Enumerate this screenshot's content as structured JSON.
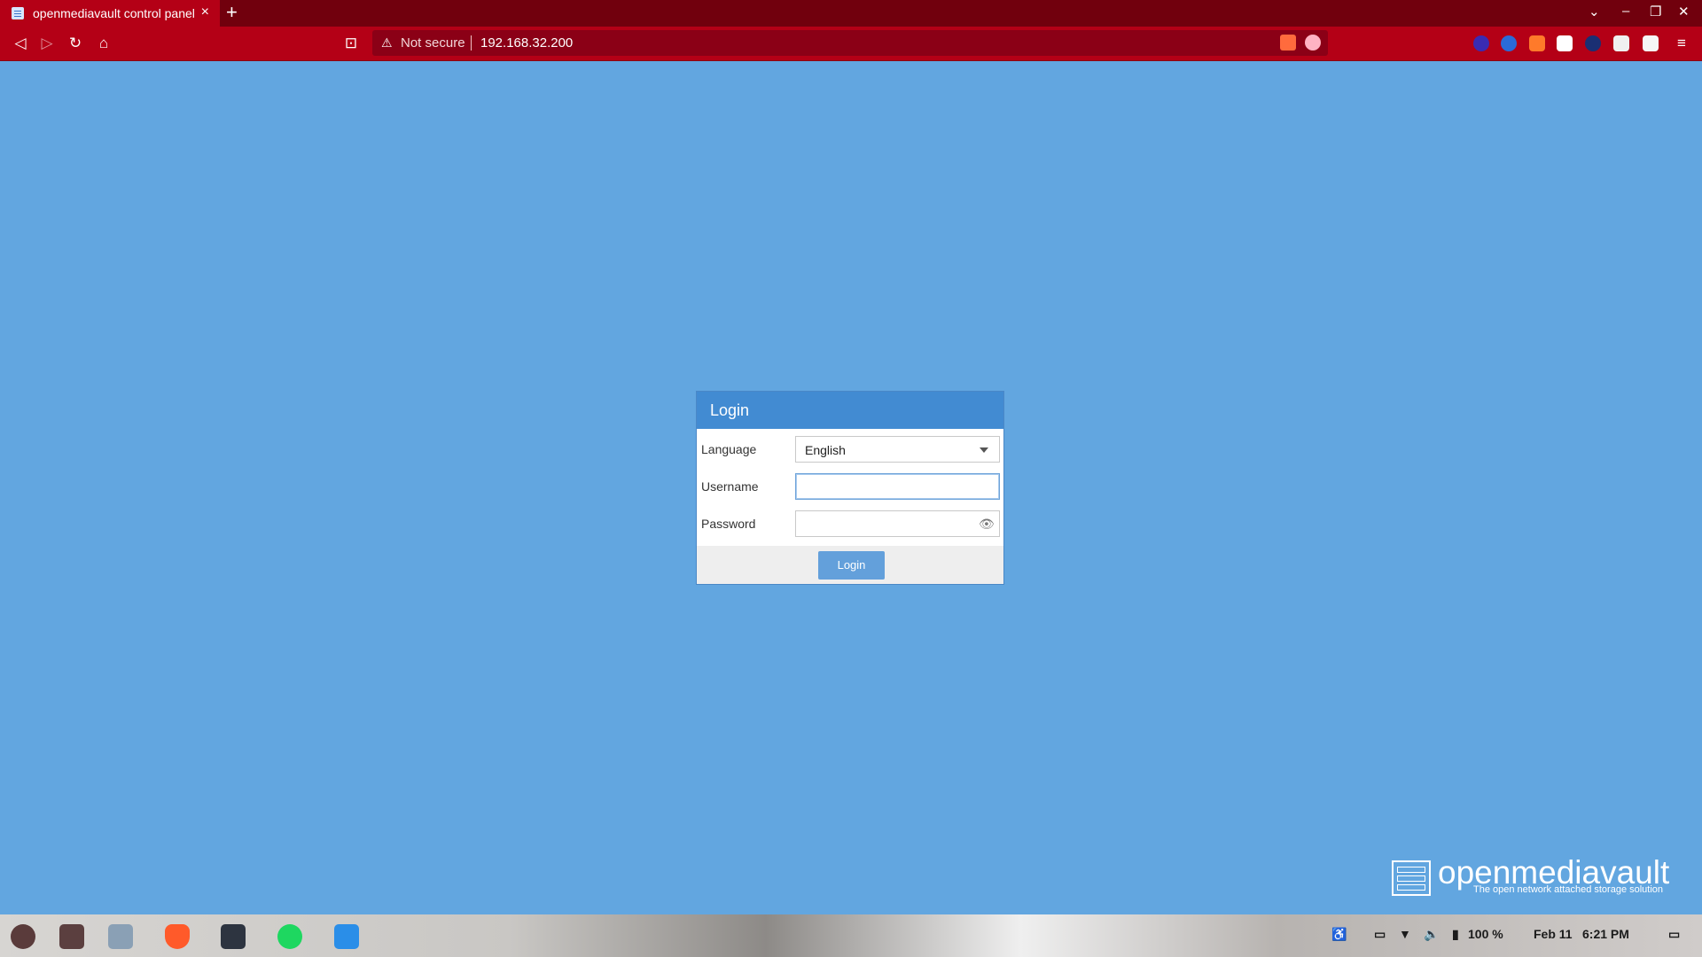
{
  "browser": {
    "tab_title": "openmediavault control panel",
    "new_tab": "+",
    "tab_close": "×",
    "security_label": "Not secure",
    "url": "192.168.32.200",
    "window_controls": [
      "⌄",
      "–",
      "❐",
      "✕"
    ]
  },
  "login": {
    "title": "Login",
    "language_label": "Language",
    "language_value": "English",
    "username_label": "Username",
    "username_value": "",
    "password_label": "Password",
    "password_value": "",
    "submit": "Login"
  },
  "branding": {
    "name": "openmediavault",
    "tagline": "The open network attached storage solution"
  },
  "taskbar": {
    "apps": [
      "zorin-menu-icon",
      "files-icon",
      "file-manager-icon",
      "brave-icon",
      "terminal-icon",
      "spotify-icon",
      "vscode-icon"
    ],
    "battery": "100 %",
    "date": "Feb 11",
    "time": "6:21 PM"
  },
  "colors": {
    "page_bg": "#62a6e0",
    "browser_chrome": "#b40016",
    "dialog_header": "#428bd2",
    "login_button": "#63a0db"
  }
}
